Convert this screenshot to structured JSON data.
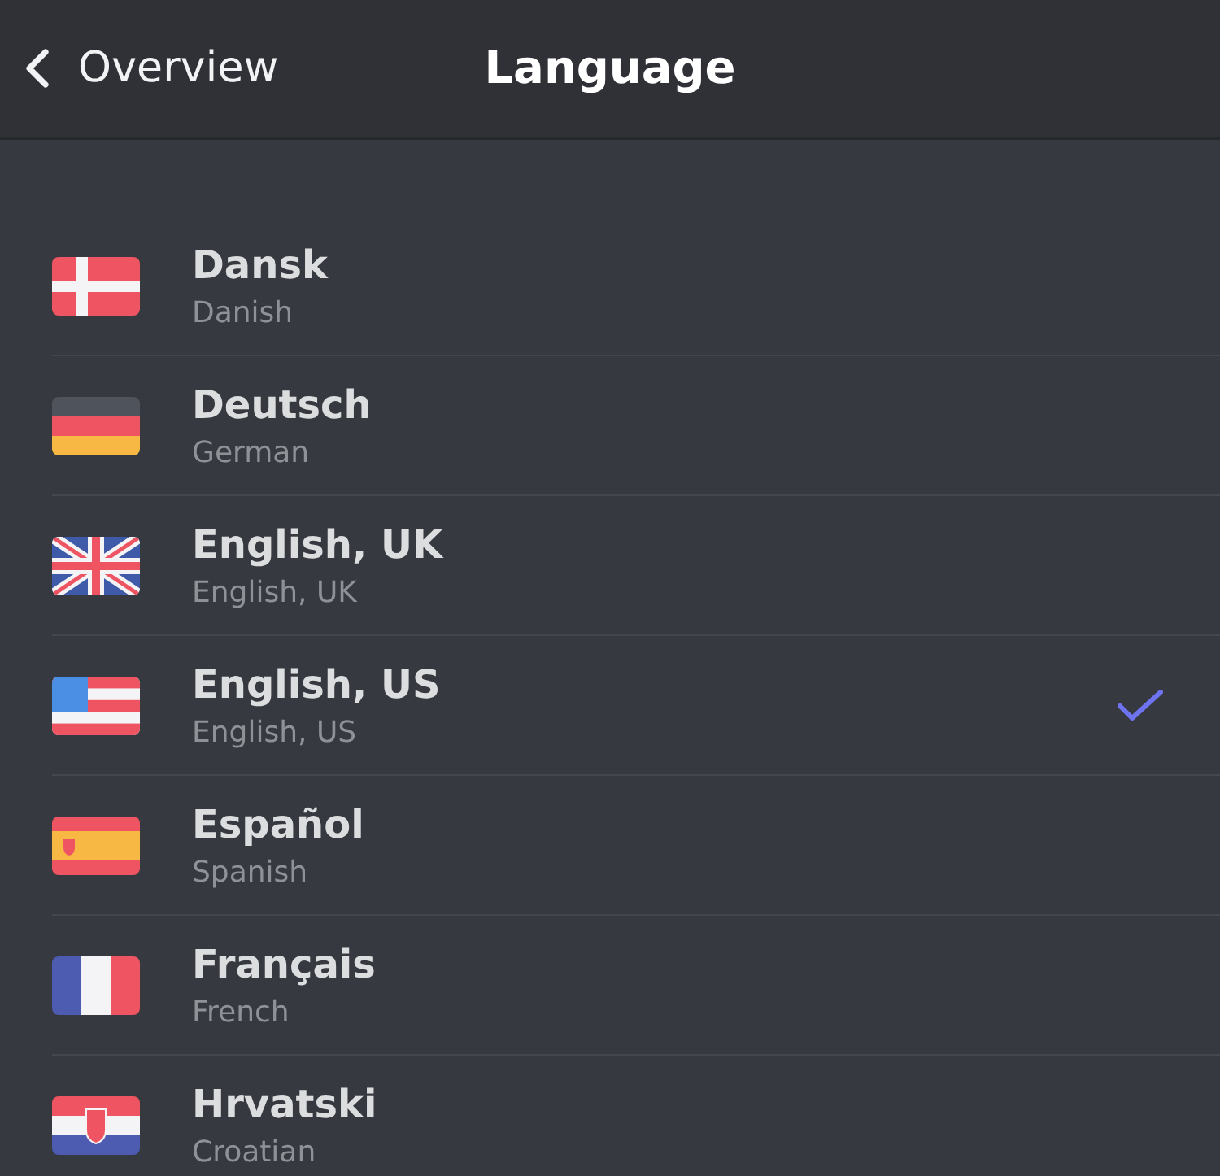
{
  "header": {
    "back_label": "Overview",
    "title": "Language"
  },
  "languages": [
    {
      "name": "Dansk",
      "subtitle": "Danish",
      "selected": false
    },
    {
      "name": "Deutsch",
      "subtitle": "German",
      "selected": false
    },
    {
      "name": "English, UK",
      "subtitle": "English, UK",
      "selected": false
    },
    {
      "name": "English, US",
      "subtitle": "English, US",
      "selected": true
    },
    {
      "name": "Español",
      "subtitle": "Spanish",
      "selected": false
    },
    {
      "name": "Français",
      "subtitle": "French",
      "selected": false
    },
    {
      "name": "Hrvatski",
      "subtitle": "Croatian",
      "selected": false
    }
  ]
}
